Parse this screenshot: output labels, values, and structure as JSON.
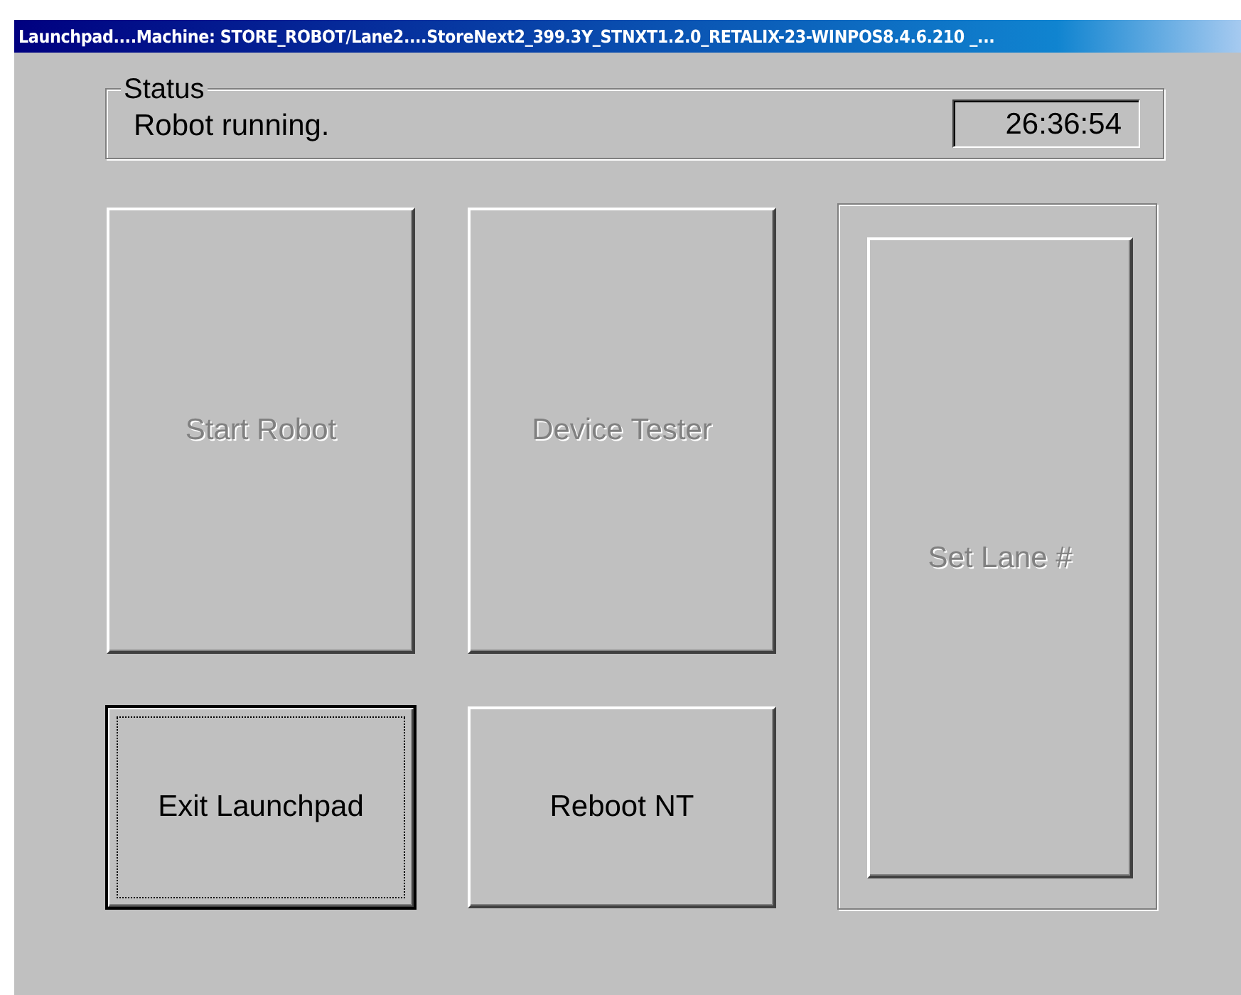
{
  "window": {
    "title": "Launchpad....Machine: STORE_ROBOT/Lane2....StoreNext2_399.3Y_STNXT1.2.0_RETALIX-23-WINPOS8.4.6.210 _..."
  },
  "status": {
    "label": "Status",
    "message": "Robot running.",
    "time": "26:36:54"
  },
  "buttons": [
    {
      "label": "Start Robot",
      "disabled": true,
      "default": false
    },
    {
      "label": "Device Tester",
      "disabled": true,
      "default": false
    },
    {
      "label": "Exit Launchpad",
      "disabled": false,
      "default": true
    },
    {
      "label": "Reboot NT",
      "disabled": false,
      "default": false
    }
  ],
  "side_panel": {
    "button": {
      "label": "Set Lane #",
      "disabled": true,
      "default": false
    }
  }
}
